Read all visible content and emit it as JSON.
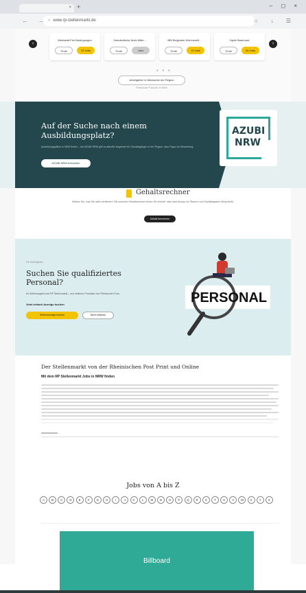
{
  "browser": {
    "tab_title": "",
    "tab_close": "×",
    "new_tab": "+",
    "window_controls": "– ◻ ×",
    "nav": "← → C",
    "url": "www.rp-stellenmarkt.de",
    "toolbar_icons": "☆ ↓ ☰"
  },
  "carousel": {
    "cards": [
      {
        "title": "Werkstatt-Fee Bedingungen",
        "btn1": "Profil",
        "btn2": "33 Jobs",
        "btn2_style": "y"
      },
      {
        "title": "Zahnärztliche Ärzte Mitte...",
        "btn1": "Profil",
        "btn2": "Jobs",
        "btn2_style": "g"
      },
      {
        "title": "BBI Bergbahn Wohnmobil...",
        "btn1": "Profil",
        "btn2": "15 Jobs",
        "btn2_style": "y"
      },
      {
        "title": "Zapfe Bauboard",
        "btn1": "Profil",
        "btn2": "26 Jobs",
        "btn2_style": "y"
      }
    ],
    "prev": "‹",
    "next": "›",
    "dots": "● ● ●",
    "all_button": "Arbeitgeber & Netzwerke der Region",
    "all_note": "Rheinische Post jobs in NRW"
  },
  "azubi": {
    "title": "Auf der Suche nach einem Ausbildungsplatz?",
    "text": "Ausbildungsplätze in NRW finden – bei AZUBI NRW gibt es aktuelle Angebote für Schulabgänger in der Region, dazu Tipps zur Bewerbung.",
    "button": "AZUBI-NRW besuchen",
    "logo_line1": "AZUBI",
    "logo_line2": "NRW"
  },
  "gehalt": {
    "title": "Gehaltsrechner",
    "text": "Wissen Sie, was Sie netto verdienen? Mit unserem Gehaltsrechner sehen Sie schnell, was nach Abzug von Steuern und Sozialabgaben übrig bleibt.",
    "button": "Gehalt berechnen"
  },
  "personal": {
    "label": "Für Arbeitgeber",
    "title": "Suchen Sie qualifiziertes Personal?",
    "text": "Ihr Stellenangebot auf RP Stellenmarkt – und weiteren Produkten der Rheinischen Post.",
    "sub": "Jetzt einfach Anzeige buchen",
    "btn1": "Stellenanzeige buchen",
    "btn2": "Mehr erfahren",
    "graphic_word": "PERSONAL",
    "colors": {
      "accent": "#f4c300",
      "figure": "#d23b2f"
    }
  },
  "stellenmarkt": {
    "title": "Der Stellenmarkt von der Rheinischen Post Print und Online",
    "subtitle": "Mit dem RP Stellenmarkt Jobs in NRW finden"
  },
  "az": {
    "title": "Jobs von A bis Z",
    "letters": [
      "A",
      "B",
      "C",
      "D",
      "E",
      "F",
      "G",
      "H",
      "I",
      "J",
      "K",
      "L",
      "M",
      "N",
      "O",
      "P",
      "Q",
      "R",
      "S",
      "T",
      "U",
      "V",
      "W",
      "X",
      "Y",
      "Z"
    ]
  },
  "billboard": {
    "label": "Billboard",
    "color": "#2faa96"
  }
}
